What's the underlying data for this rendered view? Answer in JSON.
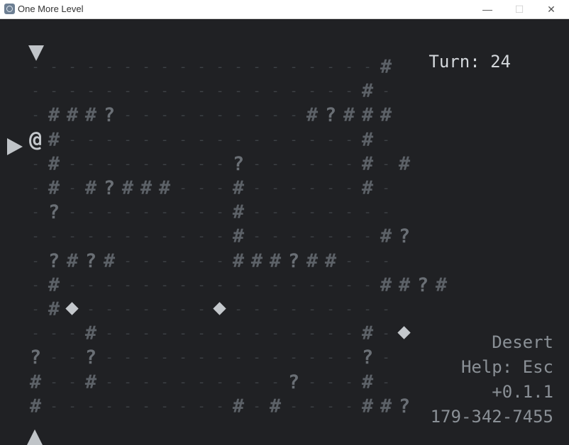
{
  "window": {
    "title": "One More Level",
    "minimize": "—",
    "maximize": "☐",
    "close": "✕"
  },
  "hud": {
    "turn_label": "Turn:",
    "turn_value": "24",
    "biome": "Desert",
    "help": "Help: Esc",
    "version": "+0.1.1",
    "seed": "179-342-7455"
  },
  "map": {
    "rows": [
      "...................#",
      "..................#.",
      ".###?..........#?###",
      "@#................#.",
      ".#.........?......#.#",
      ".#.#?###...#......#.",
      ".?.........#........",
      "...........#.......#?",
      ".?#?#......###?##...",
      ".#.................##?#",
      ".#G.......G.........",
      "...#..............#.G",
      "?..?..............?.",
      "#..#..........?...#.",
      "#..........#.#....##?"
    ]
  },
  "colors": {
    "background": "#202124",
    "wall": "#5c6167",
    "floor": "#3e4246",
    "text": "#d4d8dc",
    "dim": "#8a9096"
  }
}
